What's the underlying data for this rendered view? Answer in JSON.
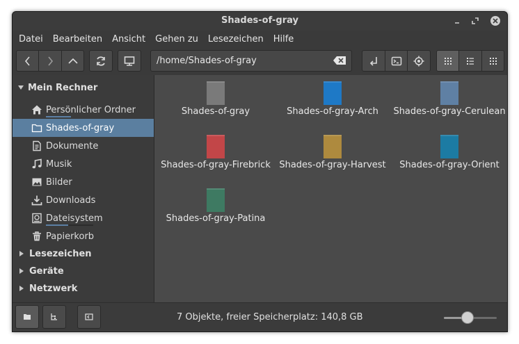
{
  "window": {
    "title": "Shades-of-gray"
  },
  "menu": [
    "Datei",
    "Bearbeiten",
    "Ansicht",
    "Gehen zu",
    "Lesezeichen",
    "Hilfe"
  ],
  "toolbar": {
    "path": "/home/Shades-of-gray",
    "buttons": [
      "back-icon",
      "forward-icon",
      "up-icon",
      "reload-icon",
      "computer-icon",
      "open-terminal-icon",
      "terminal-icon",
      "locate-icon",
      "icon-view-icon",
      "list-view-icon",
      "compact-view-icon"
    ]
  },
  "sidebar": {
    "sections": {
      "computer": "Mein Rechner",
      "bookmarks": "Lesezeichen",
      "devices": "Geräte",
      "network": "Netzwerk"
    },
    "items": [
      {
        "label": "Persönlicher Ordner",
        "icon": "home-icon",
        "active": false,
        "usage": 0.45
      },
      {
        "label": "Shades-of-gray",
        "icon": "folder-icon",
        "active": true
      },
      {
        "label": "Dokumente",
        "icon": "document-icon",
        "active": false
      },
      {
        "label": "Musik",
        "icon": "music-icon",
        "active": false
      },
      {
        "label": "Bilder",
        "icon": "image-icon",
        "active": false
      },
      {
        "label": "Downloads",
        "icon": "download-icon",
        "active": false
      },
      {
        "label": "Dateisystem",
        "icon": "drive-icon",
        "active": false,
        "usage": 0.45
      },
      {
        "label": "Papierkorb",
        "icon": "trash-icon",
        "active": false
      }
    ]
  },
  "folders": [
    {
      "name": "Shades-of-gray",
      "color": "#7a7a7a"
    },
    {
      "name": "Shades-of-gray-Arch",
      "color": "#1e79c6"
    },
    {
      "name": "Shades-of-gray-Cerulean",
      "color": "#5f80a4"
    },
    {
      "name": "Shades-of-gray-Firebrick",
      "color": "#c24648"
    },
    {
      "name": "Shades-of-gray-Harvest",
      "color": "#ae8a3e"
    },
    {
      "name": "Shades-of-gray-Orient",
      "color": "#1c7ba3"
    },
    {
      "name": "Shades-of-gray-Patina",
      "color": "#3e7a62"
    }
  ],
  "status": {
    "text": "7 Objekte, freier Speicherplatz: 140,8 GB",
    "zoom": 0.45
  },
  "colors": {
    "accent": "#5b7fa0",
    "background": "#4a4a4a"
  }
}
